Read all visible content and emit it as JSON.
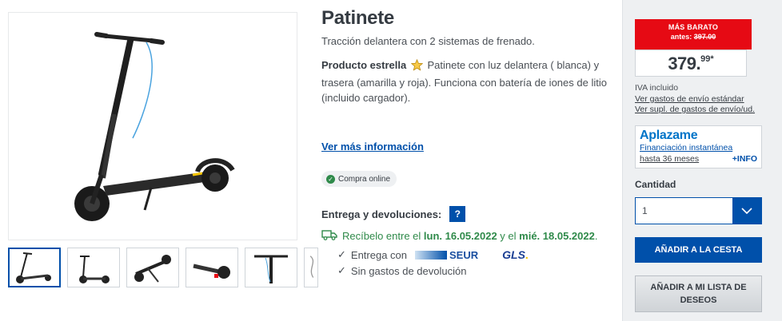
{
  "product": {
    "title": "Patinete",
    "subtitle": "Tracción delantera con 2 sistemas de frenado.",
    "highlight_label": "Producto estrella",
    "highlight_text": "Patinete con luz delantera ( blanca) y trasera (amarilla y roja). Funciona con batería de iones de litio (incluido cargador).",
    "more_link": "Ver más información",
    "online_badge": "Compra online"
  },
  "gallery": {
    "thumb_count": 6,
    "active_index": 0
  },
  "delivery": {
    "title": "Entrega y devoluciones:",
    "help_label": "?",
    "receive_prefix": "Recíbelo entre el ",
    "date_from": "lun. 16.05.2022",
    "receive_middle": " y el ",
    "date_to": "mié. 18.05.2022",
    "receive_suffix": ".",
    "carrier_line": "Entrega con",
    "carrier_1": "SEUR",
    "carrier_2_a": "GLS",
    "carrier_2_b": ".",
    "returns_line": "Sin gastos de devolución",
    "check": "✓"
  },
  "pricing": {
    "flag_label": "MÁS BARATO",
    "old_prefix": "antes: ",
    "old_price": "397.00",
    "price_main": "379.",
    "price_sup": "99*",
    "vat_note": "IVA incluido",
    "shipping_link": "Ver gastos de envío estándar",
    "shipping_extra_link": "Ver supl. de gastos de envío/ud."
  },
  "financing": {
    "brand": "Aplazame",
    "line1": "Financiación instantánea",
    "line2": "hasta 36 meses",
    "info": "+INFO"
  },
  "quantity": {
    "label": "Cantidad",
    "value": "1"
  },
  "actions": {
    "add_to_cart": "AÑADIR A LA CESTA",
    "add_to_wishlist": "AÑADIR A MI LISTA DE DESEOS"
  },
  "colors": {
    "primary_blue": "#0050aa",
    "sale_red": "#e60a14",
    "green": "#2f8a4a"
  }
}
